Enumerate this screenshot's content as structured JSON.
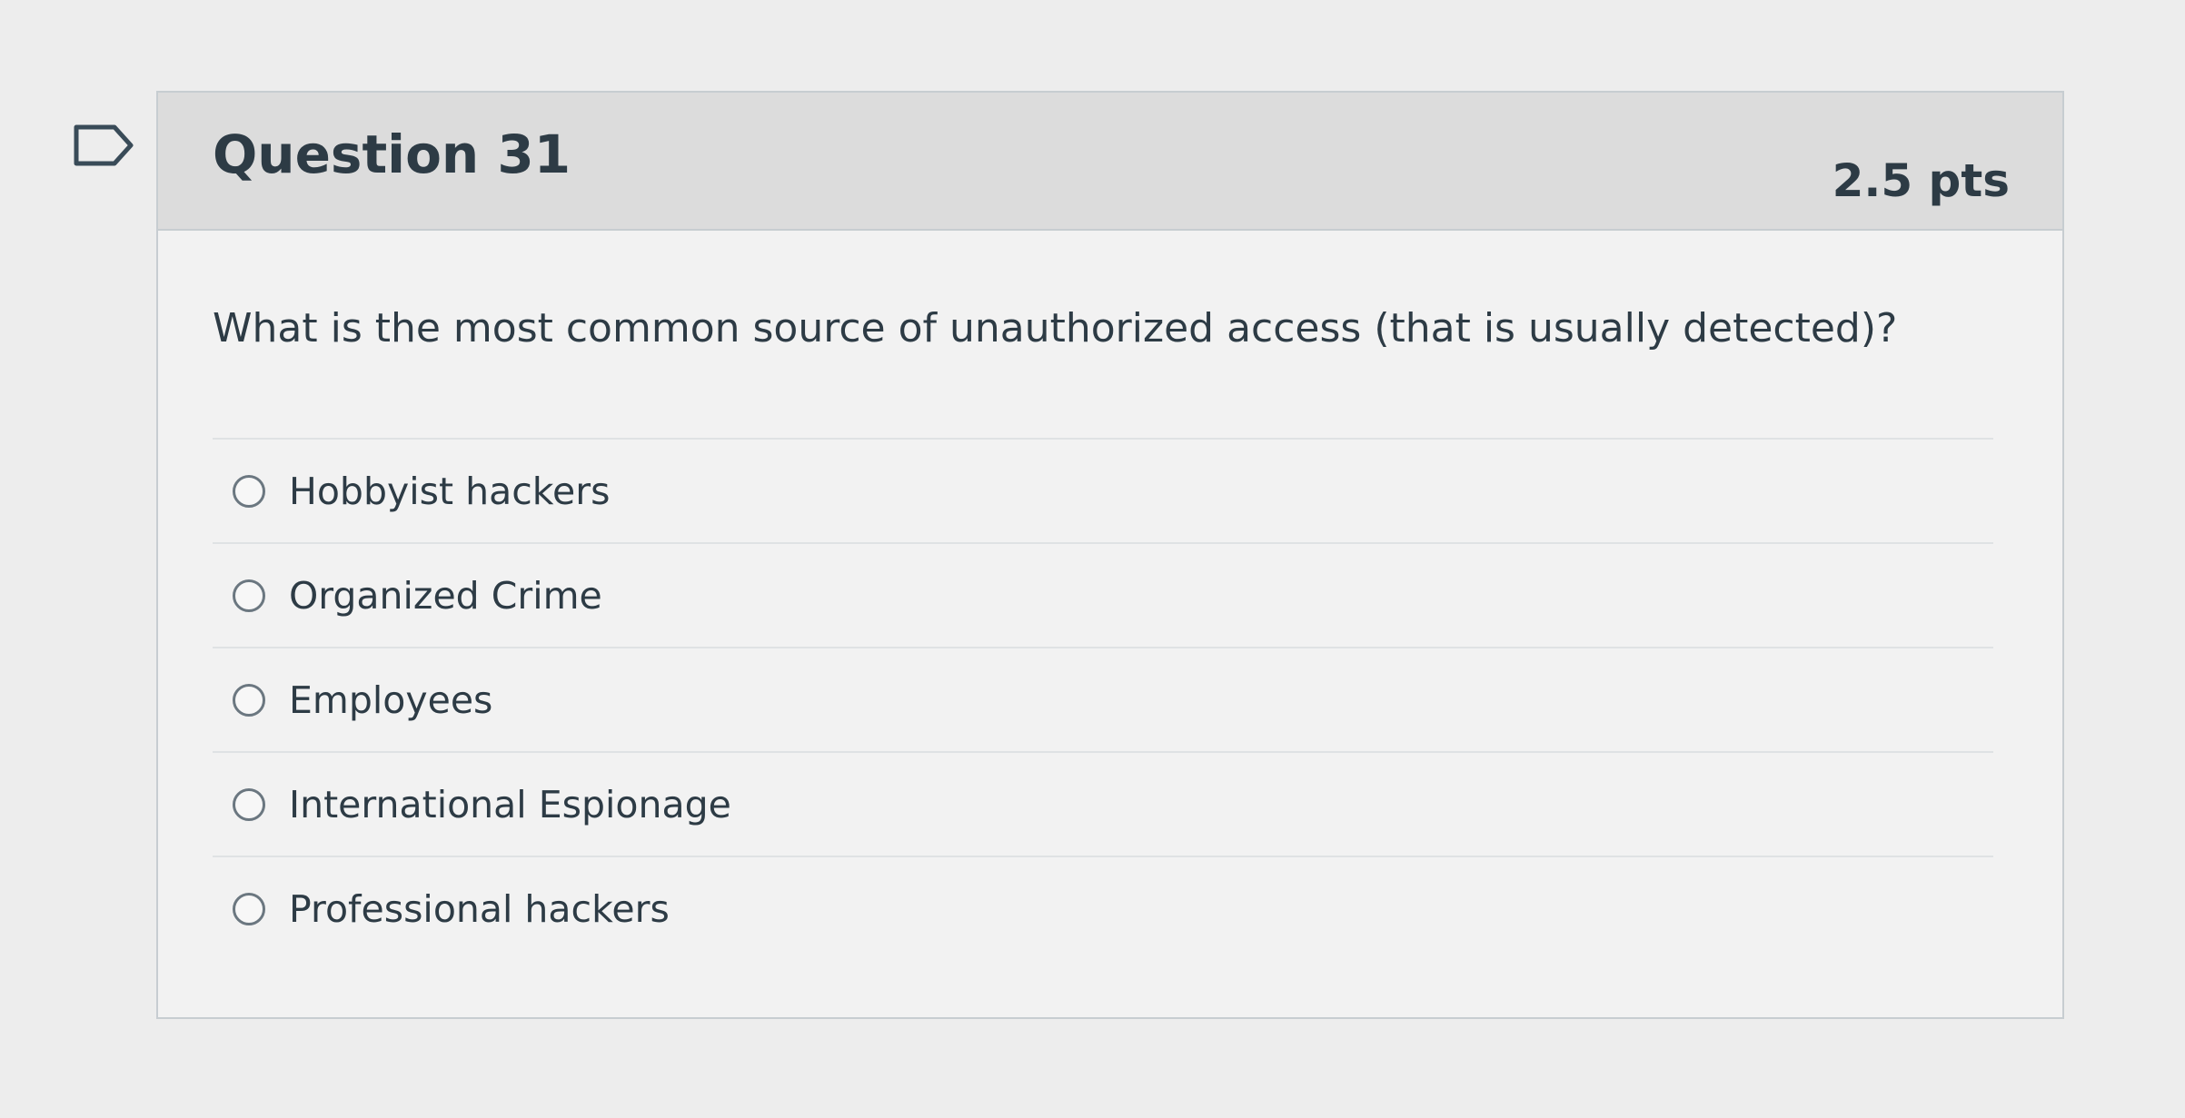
{
  "question": {
    "title": "Question 31",
    "points": "2.5 pts",
    "text": "What is the most common source of unauthorized access (that is usually detected)?",
    "flag_icon": "bookmark-flag-outline"
  },
  "answers": [
    {
      "label": "Hobbyist hackers",
      "selected": false
    },
    {
      "label": "Organized Crime",
      "selected": false
    },
    {
      "label": "Employees",
      "selected": false
    },
    {
      "label": "International Espionage",
      "selected": false
    },
    {
      "label": "Professional hackers",
      "selected": false
    }
  ],
  "colors": {
    "header_bg": "#dcdcdc",
    "body_bg": "#f2f2f2",
    "text": "#2d3b45",
    "border": "#c7cdd1"
  }
}
